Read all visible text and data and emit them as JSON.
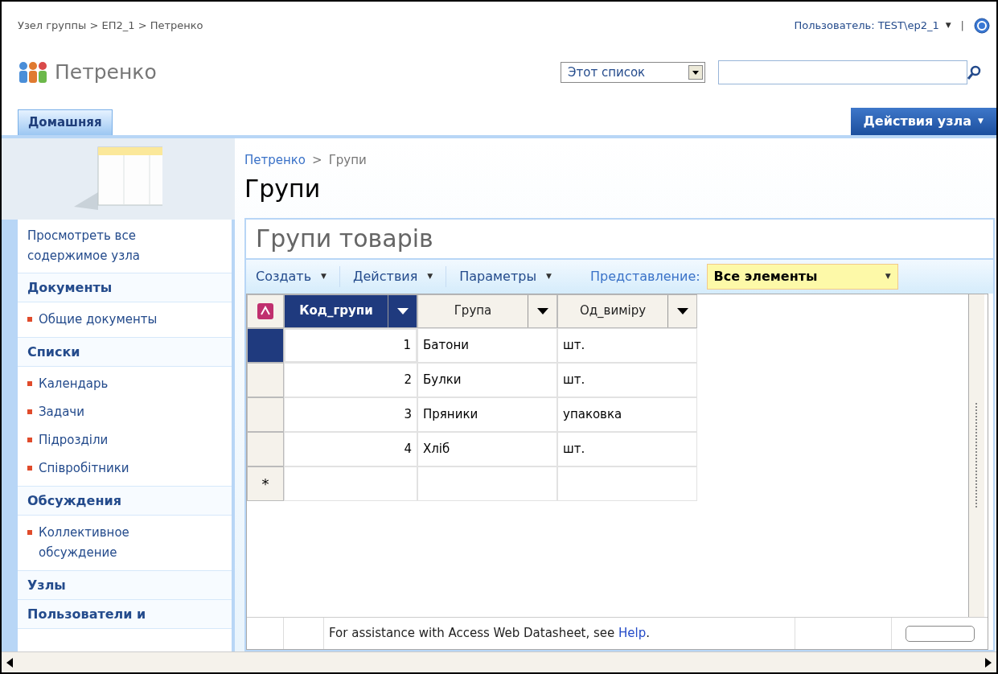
{
  "top_bar": {
    "breadcrumb": "Узел группы > ЕП2_1 > Петренко",
    "user_menu": "Пользователь: TEST\\ep2_1",
    "user_caret": "▼",
    "separator": "|"
  },
  "site": {
    "title": "Петренко",
    "search_scope": "Этот список"
  },
  "tabs": [
    {
      "label": "Домашняя",
      "selected": true
    }
  ],
  "site_actions": {
    "label": "Действия узла",
    "caret": "▼"
  },
  "sidebar": {
    "view_all": "Просмотреть все содержимое узла",
    "sections": [
      {
        "heading": "Документы",
        "items": [
          "Общие документы"
        ]
      },
      {
        "heading": "Списки",
        "items": [
          "Календарь",
          "Задачи",
          "Підрозділи",
          "Співробітники"
        ]
      },
      {
        "heading": "Обсуждения",
        "items": [
          "Коллективное обсуждение"
        ]
      },
      {
        "heading": "Узлы"
      },
      {
        "heading": "Пользователи и"
      }
    ]
  },
  "page": {
    "breadcrumb_parent": "Петренко",
    "breadcrumb_sep": ">",
    "breadcrumb_current": "Групи",
    "title": "Групи"
  },
  "list": {
    "title": "Групи товарів",
    "toolbar": [
      {
        "label": "Создать",
        "caret": "▼"
      },
      {
        "label": "Действия",
        "caret": "▼"
      },
      {
        "label": "Параметры",
        "caret": "▼"
      }
    ],
    "view_label": "Представление:",
    "view_value": "Все элементы",
    "view_caret": "▼",
    "columns": [
      {
        "label": "Код_групи",
        "selected": true
      },
      {
        "label": "Група",
        "selected": false
      },
      {
        "label": "Од_виміру",
        "selected": false
      }
    ],
    "rows": [
      {
        "selected": true,
        "cells": [
          "1",
          "Батони",
          "шт."
        ]
      },
      {
        "selected": false,
        "cells": [
          "2",
          "Булки",
          "шт."
        ]
      },
      {
        "selected": false,
        "cells": [
          "3",
          "Пряники",
          "упаковка"
        ]
      },
      {
        "selected": false,
        "cells": [
          "4",
          "Хліб",
          "шт."
        ]
      }
    ],
    "new_row_marker": "*",
    "status": {
      "text": "For assistance with Access Web Datasheet, see ",
      "link": "Help",
      "after": "."
    }
  }
}
